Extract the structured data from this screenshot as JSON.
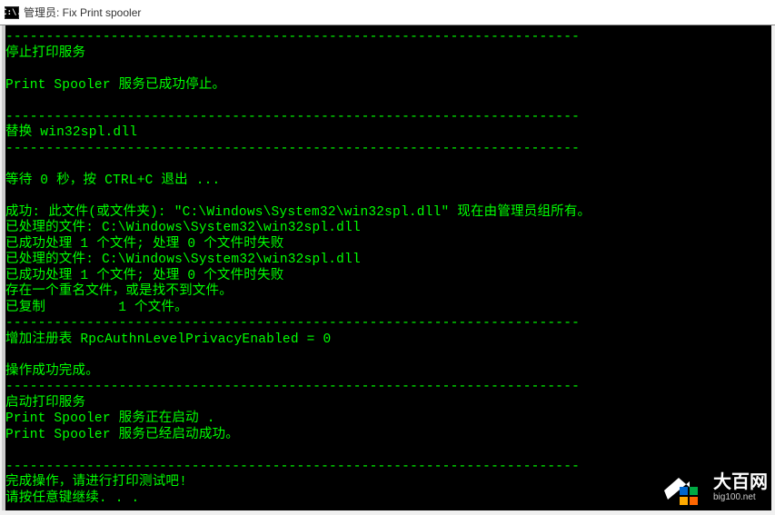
{
  "titlebar": {
    "icon_text": "C:\\.",
    "title": "管理员:  Fix Print spooler"
  },
  "terminal": {
    "lines": [
      "-----------------------------------------------------------------------",
      "停止打印服务",
      "",
      "Print Spooler 服务已成功停止。",
      "",
      "-----------------------------------------------------------------------",
      "替换 win32spl.dll",
      "-----------------------------------------------------------------------",
      "",
      "等待 0 秒，按 CTRL+C 退出 ...",
      "",
      "成功: 此文件(或文件夹): \"C:\\Windows\\System32\\win32spl.dll\" 现在由管理员组所有。",
      "已处理的文件: C:\\Windows\\System32\\win32spl.dll",
      "已成功处理 1 个文件; 处理 0 个文件时失败",
      "已处理的文件: C:\\Windows\\System32\\win32spl.dll",
      "已成功处理 1 个文件; 处理 0 个文件时失败",
      "存在一个重名文件，或是找不到文件。",
      "已复制         1 个文件。",
      "-----------------------------------------------------------------------",
      "增加注册表 RpcAuthnLevelPrivacyEnabled = 0",
      "",
      "操作成功完成。",
      "-----------------------------------------------------------------------",
      "启动打印服务",
      "Print Spooler 服务正在启动 .",
      "Print Spooler 服务已经启动成功。",
      "",
      "-----------------------------------------------------------------------",
      "完成操作，请进行打印测试吧!",
      "请按任意键继续. . ."
    ]
  },
  "watermark": {
    "name": "大百网",
    "url": "big100.net"
  }
}
